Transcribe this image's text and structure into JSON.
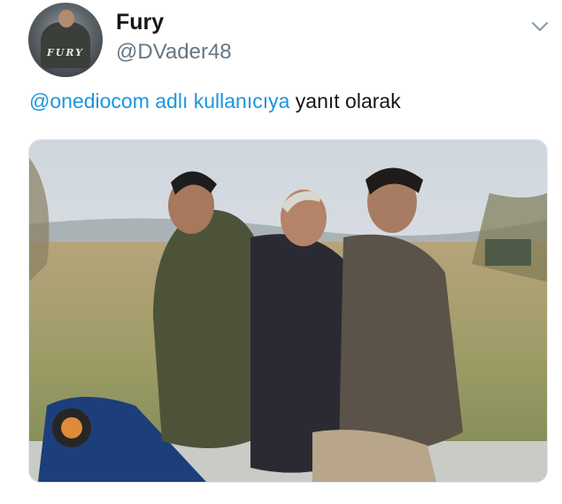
{
  "tweet": {
    "display_name": "Fury",
    "handle": "@DVader48",
    "reply_mention": "@onediocom",
    "reply_link": "adlı kullanıcıya",
    "reply_rest": " yanıt olarak",
    "avatar_logo": "FURY",
    "menu_icon": "chevron-down-icon",
    "photo_icon": "photo"
  },
  "colors": {
    "link": "#1b95e0",
    "text": "#14171a",
    "secondary": "#657786"
  }
}
